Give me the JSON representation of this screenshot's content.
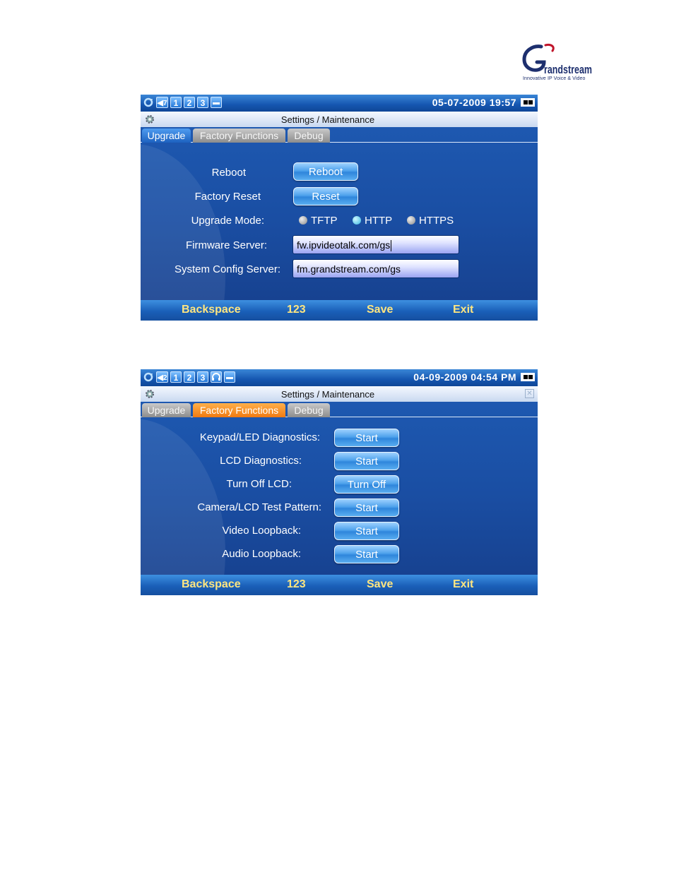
{
  "logo": {
    "brand": "Grandstream",
    "tagline": "Innovative IP Voice & Video"
  },
  "screen1": {
    "status": {
      "icons": [
        "sync-icon",
        "volume-icon",
        "1",
        "2",
        "3",
        "clapper-icon"
      ],
      "volume": "7",
      "line1": "1",
      "line2": "2",
      "line3": "3",
      "datetime": "05-07-2009 19:57"
    },
    "title": "Settings / Maintenance",
    "tabs": [
      "Upgrade",
      "Factory Functions",
      "Debug"
    ],
    "active_tab": "Upgrade",
    "rows": {
      "reboot_label": "Reboot",
      "reboot_button": "Reboot",
      "factory_reset_label": "Factory Reset",
      "reset_button": "Reset",
      "upgrade_mode_label": "Upgrade Mode:",
      "upgrade_modes": [
        "TFTP",
        "HTTP",
        "HTTPS"
      ],
      "selected_mode": "HTTP",
      "firmware_label": "Firmware Server:",
      "firmware_value": "fw.ipvideotalk.com/gs",
      "config_label": "System Config Server:",
      "config_value": "fm.grandstream.com/gs"
    },
    "softkeys": [
      "Backspace",
      "123",
      "Save",
      "Exit"
    ]
  },
  "screen2": {
    "status": {
      "icons": [
        "sync-icon",
        "volume-icon",
        "1",
        "2",
        "3",
        "headset-icon",
        "clapper-icon"
      ],
      "volume": "2",
      "line1": "1",
      "line2": "2",
      "line3": "3",
      "datetime": "04-09-2009 04:54 PM"
    },
    "title": "Settings / Maintenance",
    "tabs": [
      "Upgrade",
      "Factory Functions",
      "Debug"
    ],
    "active_tab": "Factory Functions",
    "rows": [
      {
        "label": "Keypad/LED Diagnostics:",
        "button": "Start"
      },
      {
        "label": "LCD Diagnostics:",
        "button": "Start"
      },
      {
        "label": "Turn Off LCD:",
        "button": "Turn Off"
      },
      {
        "label": "Camera/LCD Test Pattern:",
        "button": "Start"
      },
      {
        "label": "Video Loopback:",
        "button": "Start"
      },
      {
        "label": "Audio Loopback:",
        "button": "Start"
      }
    ],
    "softkeys": [
      "Backspace",
      "123",
      "Save",
      "Exit"
    ]
  },
  "colors": {
    "screen_blue": "#1a4ea3",
    "tab_active_blue": "#1d62c0",
    "tab_active_orange": "#f07a12",
    "softkey_text": "#ffe680"
  }
}
